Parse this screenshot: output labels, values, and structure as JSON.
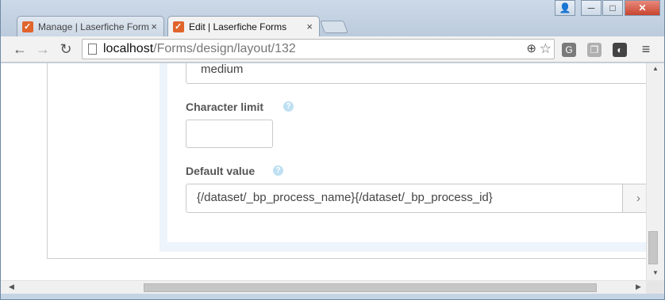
{
  "browser": {
    "tabs": [
      {
        "label": "Manage | Laserfiche Forms",
        "favicon": "laserfiche-check-icon",
        "close": "×",
        "active": false
      },
      {
        "label": "Edit | Laserfiche Forms",
        "favicon": "laserfiche-check-icon",
        "close": "×",
        "active": true
      }
    ],
    "window_controls": {
      "profile": "👤",
      "minimize": "─",
      "maximize": "□",
      "close": "✕"
    },
    "nav": {
      "back": "←",
      "forward": "→",
      "reload": "↻"
    },
    "address": {
      "host": "localhost",
      "path": "/Forms/design/layout/132",
      "zoom_icon": "⊕",
      "star_icon": "☆"
    },
    "extensions": [
      {
        "name": "g-extension-icon",
        "glyph": "G",
        "color": "#7a7a7a"
      },
      {
        "name": "copy-extension-icon",
        "glyph": "❐",
        "color": "#8c8c8c"
      },
      {
        "name": "dark-extension-icon",
        "glyph": "◐",
        "color": "#444444"
      }
    ],
    "menu_icon": "≡"
  },
  "form": {
    "size_value": "medium",
    "character_limit": {
      "label": "Character limit",
      "help": "?",
      "value": ""
    },
    "default_value": {
      "label": "Default value",
      "help": "?",
      "value": "{/dataset/_bp_process_name}{/dataset/_bp_process_id}",
      "addon": "›"
    }
  },
  "colors": {
    "favicon": "#e0642b",
    "help_icon": "#bfe0f3",
    "panel_bg": "#eef4fb"
  }
}
